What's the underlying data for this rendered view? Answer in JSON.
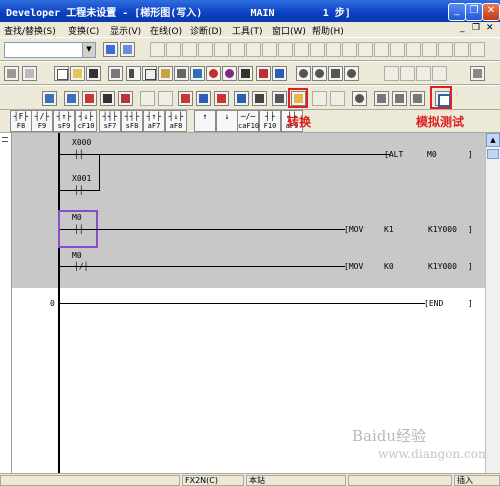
{
  "window": {
    "title": "Developer 工程未设置 - [梯形图(写入)        MAIN        1 步]",
    "minimize": "_",
    "restore": "❐",
    "close": "✕"
  },
  "menu": {
    "items": [
      "查找/替换(S)",
      "变换(C)",
      "显示(V)",
      "在线(O)",
      "诊断(D)",
      "工具(T)",
      "窗口(W)",
      "帮助(H)"
    ],
    "doc_controls": [
      "_",
      "❐",
      "✕"
    ]
  },
  "toolbar": {
    "combo_value": ""
  },
  "fkeys": [
    {
      "sym": "┤F├",
      "label": "F8"
    },
    {
      "sym": "┤/├",
      "label": "F9"
    },
    {
      "sym": "┤↑├",
      "label": "sF9"
    },
    {
      "sym": "┤↓├",
      "label": "cF10"
    },
    {
      "sym": "┤┤├",
      "label": "sF7"
    },
    {
      "sym": "┤┤├",
      "label": "sF8"
    },
    {
      "sym": "┤↑├",
      "label": "aF7"
    },
    {
      "sym": "┤↓├",
      "label": "aF8"
    },
    {
      "sym": "↑",
      "label": ""
    },
    {
      "sym": "↓",
      "label": ""
    },
    {
      "sym": "─/─",
      "label": "caF10"
    },
    {
      "sym": "┤├",
      "label": "F10"
    },
    {
      "sym": "┤├",
      "label": "aF9"
    }
  ],
  "annotations": {
    "convert": "转换",
    "simulate": "模拟测试"
  },
  "ladder": {
    "rungs": [
      {
        "contacts": [
          "X000",
          "X001"
        ],
        "instruction": "[ALT",
        "op1": "M0",
        "op2": "",
        "close": "]"
      },
      {
        "contacts": [
          "M0"
        ],
        "instruction": "[MOV",
        "op1": "K1",
        "op2": "K1Y000",
        "close": "]"
      },
      {
        "contacts": [
          "M0"
        ],
        "instruction": "[MOV",
        "op1": "K0",
        "op2": "K1Y000",
        "close": "]"
      },
      {
        "step": "0",
        "instruction": "[END",
        "close": "]"
      }
    ]
  },
  "status": {
    "cpu": "FX2N(C)",
    "station": "本站",
    "mode": "插入"
  },
  "watermark": {
    "brand": "Baidu经验",
    "url": "www.diangon.com"
  }
}
